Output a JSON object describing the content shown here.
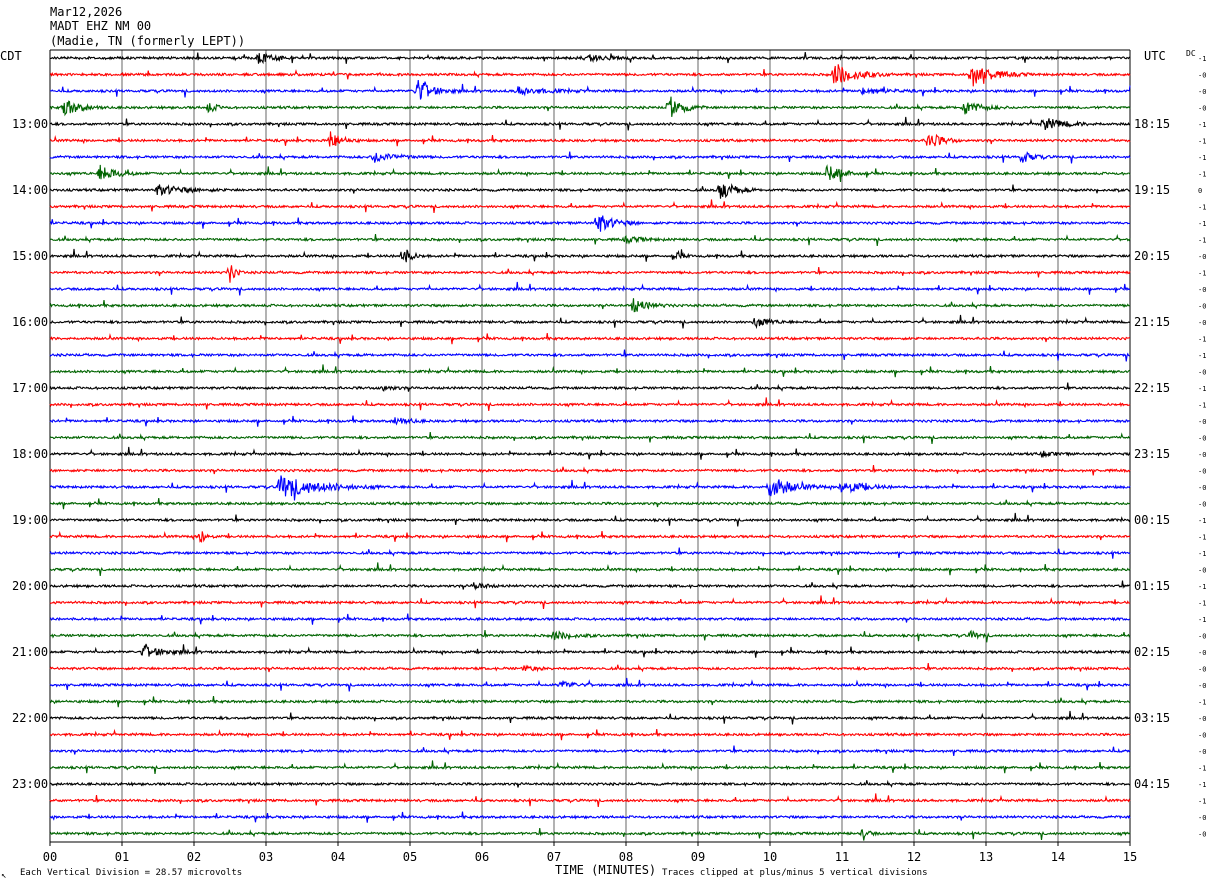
{
  "header": {
    "date": "Mar12,2026",
    "station": "MADT EHZ NM 00",
    "location": "(Madie, TN (formerly LEPT))"
  },
  "left_timezone": "CDT",
  "right_timezone": "UTC",
  "dc_label": "DC",
  "footer": {
    "left_glyph": "↖",
    "division_note": "Each Vertical Division =   28.57 microvolts",
    "xlabel": "TIME (MINUTES)",
    "clip_note": "Traces clipped at plus/minus 5 vertical divisions"
  },
  "colors": {
    "trace_cycle": [
      "#000000",
      "#ff0000",
      "#0000ff",
      "#006400"
    ],
    "grid": "#000000",
    "background": "#ffffff"
  },
  "chart_data": {
    "type": "line",
    "title": "MADT EHZ NM 00",
    "xlabel": "TIME (MINUTES)",
    "xlim": [
      0,
      15
    ],
    "x_ticks": [
      "00",
      "01",
      "02",
      "03",
      "04",
      "05",
      "06",
      "07",
      "08",
      "09",
      "10",
      "11",
      "12",
      "13",
      "14",
      "15"
    ],
    "row_interval_minutes": 15,
    "row_count": 48,
    "left_hour_labels": [
      "13:00",
      "14:00",
      "15:00",
      "16:00",
      "17:00",
      "18:00",
      "19:00",
      "20:00",
      "21:00",
      "22:00",
      "23:00"
    ],
    "right_hour_labels": [
      "18:15",
      "19:15",
      "20:15",
      "21:15",
      "22:15",
      "23:15",
      "00:15",
      "01:15",
      "02:15",
      "03:15",
      "04:15"
    ],
    "hour_label_first_row": 4,
    "hour_label_row_step": 4,
    "dc_offsets": [
      "-1",
      "-0",
      "-0",
      "-0",
      "-1",
      "-1",
      "-1",
      "-1",
      "0",
      "-1",
      "-1",
      "-1",
      "-0",
      "-1",
      "-0",
      "-0",
      "-0",
      "-1",
      "-1",
      "-0",
      "-1",
      "-1",
      "-0",
      "-0",
      "-0",
      "-0",
      "-0",
      "-0",
      "-1",
      "-1",
      "-1",
      "-0",
      "-1",
      "-1",
      "-1",
      "-0",
      "-0",
      "-0",
      "-0",
      "-1",
      "-0",
      "-0",
      "-0",
      "-1",
      "-1",
      "-1",
      "-0",
      "-0"
    ],
    "events": [
      {
        "row": 0,
        "minute": 2.9,
        "amp": 6,
        "dur": 0.5
      },
      {
        "row": 0,
        "minute": 7.5,
        "amp": 3,
        "dur": 0.6
      },
      {
        "row": 1,
        "minute": 10.9,
        "amp": 12,
        "dur": 0.8
      },
      {
        "row": 1,
        "minute": 12.8,
        "amp": 12,
        "dur": 0.8
      },
      {
        "row": 2,
        "minute": 5.1,
        "amp": 12,
        "dur": 0.6
      },
      {
        "row": 2,
        "minute": 6.5,
        "amp": 4,
        "dur": 1.0
      },
      {
        "row": 2,
        "minute": 11.3,
        "amp": 4,
        "dur": 0.7
      },
      {
        "row": 3,
        "minute": 0.2,
        "amp": 9,
        "dur": 0.6
      },
      {
        "row": 3,
        "minute": 2.2,
        "amp": 5,
        "dur": 0.3
      },
      {
        "row": 3,
        "minute": 8.6,
        "amp": 12,
        "dur": 0.5
      },
      {
        "row": 3,
        "minute": 12.7,
        "amp": 7,
        "dur": 0.6
      },
      {
        "row": 4,
        "minute": 13.8,
        "amp": 6,
        "dur": 0.8
      },
      {
        "row": 5,
        "minute": 3.9,
        "amp": 10,
        "dur": 0.4
      },
      {
        "row": 5,
        "minute": 12.2,
        "amp": 9,
        "dur": 0.5
      },
      {
        "row": 6,
        "minute": 4.5,
        "amp": 5,
        "dur": 0.8
      },
      {
        "row": 6,
        "minute": 13.5,
        "amp": 6,
        "dur": 0.4
      },
      {
        "row": 7,
        "minute": 0.7,
        "amp": 8,
        "dur": 0.6
      },
      {
        "row": 7,
        "minute": 10.8,
        "amp": 8,
        "dur": 0.6
      },
      {
        "row": 8,
        "minute": 9.3,
        "amp": 12,
        "dur": 0.5
      },
      {
        "row": 8,
        "minute": 1.5,
        "amp": 5,
        "dur": 1.0
      },
      {
        "row": 10,
        "minute": 7.6,
        "amp": 10,
        "dur": 0.6
      },
      {
        "row": 11,
        "minute": 8.0,
        "amp": 3,
        "dur": 0.6
      },
      {
        "row": 12,
        "minute": 4.9,
        "amp": 10,
        "dur": 0.3
      },
      {
        "row": 12,
        "minute": 8.7,
        "amp": 6,
        "dur": 0.2
      },
      {
        "row": 13,
        "minute": 2.5,
        "amp": 10,
        "dur": 0.2
      },
      {
        "row": 15,
        "minute": 8.1,
        "amp": 7,
        "dur": 0.6
      },
      {
        "row": 16,
        "minute": 9.8,
        "amp": 5,
        "dur": 0.5
      },
      {
        "row": 20,
        "minute": 4.6,
        "amp": 3,
        "dur": 0.4
      },
      {
        "row": 22,
        "minute": 4.8,
        "amp": 4,
        "dur": 0.5
      },
      {
        "row": 24,
        "minute": 13.8,
        "amp": 3,
        "dur": 0.4
      },
      {
        "row": 26,
        "minute": 3.2,
        "amp": 12,
        "dur": 1.4
      },
      {
        "row": 26,
        "minute": 10.0,
        "amp": 12,
        "dur": 0.8
      },
      {
        "row": 26,
        "minute": 11.0,
        "amp": 7,
        "dur": 0.8
      },
      {
        "row": 29,
        "minute": 2.1,
        "amp": 8,
        "dur": 0.2
      },
      {
        "row": 32,
        "minute": 5.9,
        "amp": 4,
        "dur": 0.4
      },
      {
        "row": 35,
        "minute": 7.0,
        "amp": 4,
        "dur": 0.7
      },
      {
        "row": 35,
        "minute": 12.8,
        "amp": 4,
        "dur": 0.3
      },
      {
        "row": 36,
        "minute": 1.3,
        "amp": 6,
        "dur": 0.8
      },
      {
        "row": 37,
        "minute": 6.6,
        "amp": 3,
        "dur": 0.4
      },
      {
        "row": 38,
        "minute": 7.1,
        "amp": 4,
        "dur": 0.5
      },
      {
        "row": 47,
        "minute": 11.3,
        "amp": 6,
        "dur": 0.2
      }
    ]
  }
}
